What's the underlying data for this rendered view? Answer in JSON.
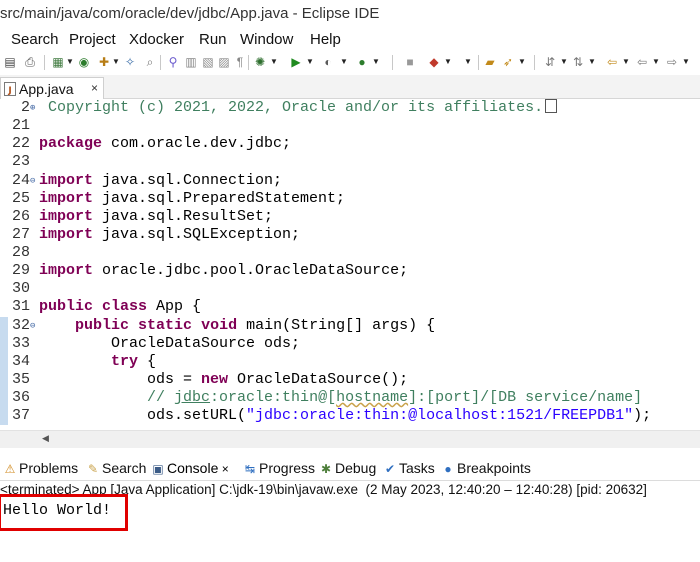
{
  "window": {
    "title": "src/main/java/com/oracle/dev/jdbc/App.java - Eclipse IDE"
  },
  "menu": [
    "Search",
    "Project",
    "Xdocker",
    "Run",
    "Window",
    "Help"
  ],
  "toolbar": {
    "icons": [
      "save-icon",
      "print-icon",
      "debug-icon",
      "new-java-icon",
      "run-icon",
      "external-tools-icon",
      "skip-breakpoints-icon",
      "next-annotation-icon",
      "back-icon",
      "forward-icon"
    ]
  },
  "editor": {
    "tab": {
      "label": "App.java",
      "close": "×"
    },
    "lines": [
      {
        "n": "2",
        "fold": "⊕",
        "marker": false,
        "tokens": [
          {
            "t": " Copyright (c) 2021, 2022, Oracle and/or its affiliates.",
            "c": "cm"
          },
          {
            "t": "",
            "c": "box"
          }
        ]
      },
      {
        "n": "21",
        "fold": "",
        "marker": false,
        "tokens": []
      },
      {
        "n": "22",
        "fold": "",
        "marker": false,
        "tokens": [
          {
            "t": "package",
            "c": "kw"
          },
          {
            "t": " com.oracle.dev.jdbc;",
            "c": ""
          }
        ]
      },
      {
        "n": "23",
        "fold": "",
        "marker": false,
        "tokens": []
      },
      {
        "n": "24",
        "fold": "⊖",
        "marker": false,
        "tokens": [
          {
            "t": "import",
            "c": "kw"
          },
          {
            "t": " java.sql.Connection;",
            "c": ""
          }
        ]
      },
      {
        "n": "25",
        "fold": "",
        "marker": false,
        "tokens": [
          {
            "t": "import",
            "c": "kw"
          },
          {
            "t": " java.sql.PreparedStatement;",
            "c": ""
          }
        ]
      },
      {
        "n": "26",
        "fold": "",
        "marker": false,
        "tokens": [
          {
            "t": "import",
            "c": "kw"
          },
          {
            "t": " java.sql.ResultSet;",
            "c": ""
          }
        ]
      },
      {
        "n": "27",
        "fold": "",
        "marker": false,
        "tokens": [
          {
            "t": "import",
            "c": "kw"
          },
          {
            "t": " java.sql.SQLException;",
            "c": ""
          }
        ]
      },
      {
        "n": "28",
        "fold": "",
        "marker": false,
        "tokens": []
      },
      {
        "n": "29",
        "fold": "",
        "marker": false,
        "tokens": [
          {
            "t": "import",
            "c": "kw"
          },
          {
            "t": " oracle.jdbc.pool.OracleDataSource;",
            "c": ""
          }
        ]
      },
      {
        "n": "30",
        "fold": "",
        "marker": false,
        "tokens": []
      },
      {
        "n": "31",
        "fold": "",
        "marker": false,
        "tokens": [
          {
            "t": "public",
            "c": "kw"
          },
          {
            "t": " ",
            "c": ""
          },
          {
            "t": "class",
            "c": "kw"
          },
          {
            "t": " App {",
            "c": ""
          }
        ]
      },
      {
        "n": "32",
        "fold": "⊖",
        "marker": true,
        "tokens": [
          {
            "t": "    ",
            "c": ""
          },
          {
            "t": "public",
            "c": "kw"
          },
          {
            "t": " ",
            "c": ""
          },
          {
            "t": "static",
            "c": "kw"
          },
          {
            "t": " ",
            "c": ""
          },
          {
            "t": "void",
            "c": "kw"
          },
          {
            "t": " main(String[] args) {",
            "c": ""
          }
        ]
      },
      {
        "n": "33",
        "fold": "",
        "marker": true,
        "tokens": [
          {
            "t": "        OracleDataSource ods;",
            "c": ""
          }
        ]
      },
      {
        "n": "34",
        "fold": "",
        "marker": true,
        "tokens": [
          {
            "t": "        ",
            "c": ""
          },
          {
            "t": "try",
            "c": "kw"
          },
          {
            "t": " {",
            "c": ""
          }
        ]
      },
      {
        "n": "35",
        "fold": "",
        "marker": true,
        "tokens": [
          {
            "t": "            ods = ",
            "c": ""
          },
          {
            "t": "new",
            "c": "kw"
          },
          {
            "t": " OracleDataSource();",
            "c": ""
          }
        ]
      },
      {
        "n": "36",
        "fold": "",
        "marker": true,
        "tokens": [
          {
            "t": "            // ",
            "c": "cm"
          },
          {
            "t": "jdbc",
            "c": "cm link"
          },
          {
            "t": ":oracle:thin@[",
            "c": "cm"
          },
          {
            "t": "hostname",
            "c": "cm squig"
          },
          {
            "t": "]:[port]/[DB service/name]",
            "c": "cm"
          }
        ]
      },
      {
        "n": "37",
        "fold": "",
        "marker": true,
        "tokens": [
          {
            "t": "            ods.setURL(",
            "c": ""
          },
          {
            "t": "\"jdbc:oracle:thin:@localhost:1521/FREEPDB1\"",
            "c": "str"
          },
          {
            "t": ");",
            "c": ""
          }
        ]
      }
    ]
  },
  "views": {
    "tabs": [
      {
        "label": "Problems",
        "icon": "problems-icon",
        "glyph": "⚠",
        "color": "#d18a1e"
      },
      {
        "label": "Search",
        "icon": "search-icon",
        "glyph": "✎",
        "color": "#c9a24a"
      },
      {
        "label": "Console",
        "icon": "console-icon",
        "glyph": "▣",
        "color": "#3b5b87",
        "close": "×"
      },
      {
        "label": "Progress",
        "icon": "progress-icon",
        "glyph": "↹",
        "color": "#2f6fc0"
      },
      {
        "label": "Debug",
        "icon": "debug-icon",
        "glyph": "✱",
        "color": "#4d7e3a"
      },
      {
        "label": "Tasks",
        "icon": "tasks-icon",
        "glyph": "✔",
        "color": "#2f6fc0"
      },
      {
        "label": "Breakpoints",
        "icon": "breakpoints-icon",
        "glyph": "●",
        "color": "#2f6fc0"
      }
    ]
  },
  "console": {
    "status": "<terminated> App [Java Application] C:\\jdk-19\\bin\\javaw.exe  (2 May 2023, 12:40:20 – 12:40:28) [pid: 20632]",
    "output": "Hello World!"
  }
}
